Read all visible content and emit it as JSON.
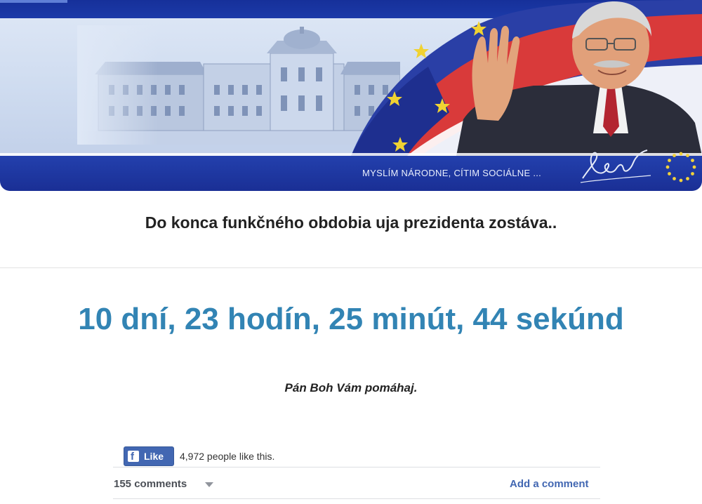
{
  "banner": {
    "motto": "MYSLÍM NÁRODNE, CÍTIM SOCIÁLNE ...",
    "images": [
      "palace-illustration",
      "slovak-and-eu-flags",
      "president-waving-photo",
      "signature",
      "eu-stars-emblem"
    ]
  },
  "main": {
    "subtitle": "Do konca funkčného obdobia uja prezidenta zostáva..",
    "countdown": "10 dní, 23 hodín, 25 minút, 44 sekúnd",
    "blessing": "Pán Boh Vám pomáhaj."
  },
  "facebook": {
    "like_label": "Like",
    "like_count_text": "4,972 people like this.",
    "comments_count": "155 comments",
    "add_comment": "Add a comment",
    "icons": [
      "facebook-f-icon",
      "chevron-down-icon"
    ]
  },
  "colors": {
    "banner_blue": "#1a2f95",
    "countdown": "#3284b4",
    "facebook_blue": "#4267b2",
    "text_dark": "#222222"
  }
}
